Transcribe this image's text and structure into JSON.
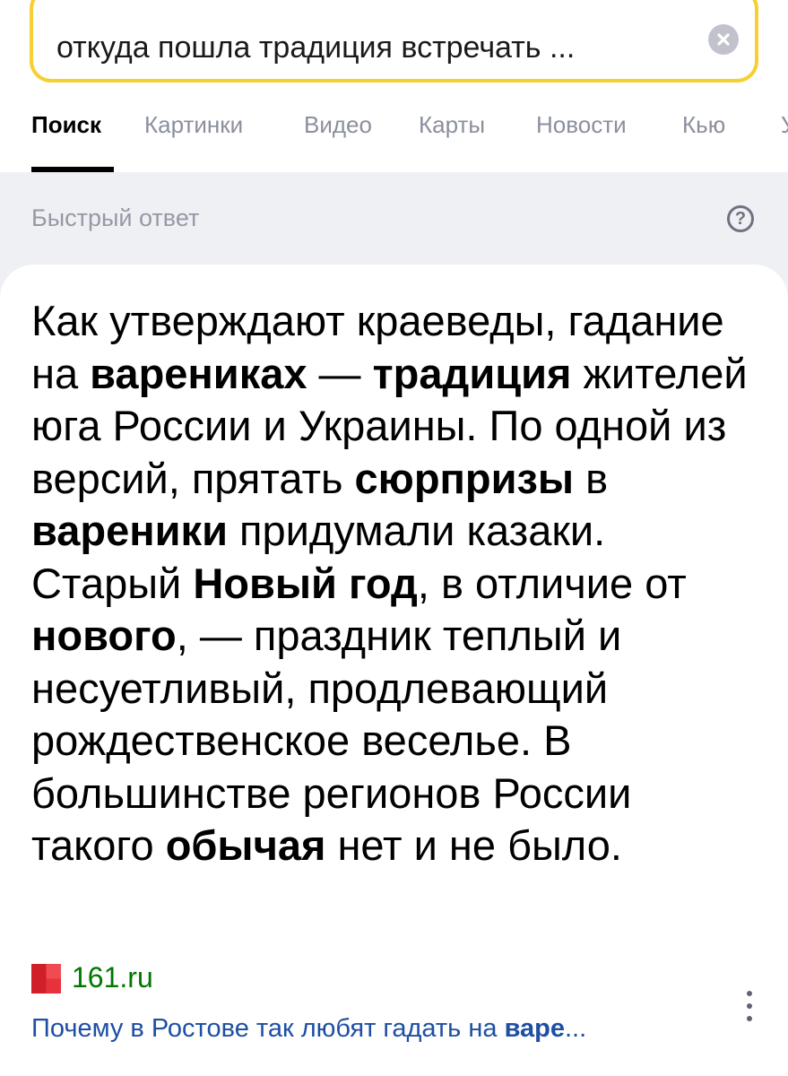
{
  "search": {
    "query": "откуда пошла традиция встречать ..."
  },
  "tabs": [
    {
      "label": "Поиск",
      "active": true
    },
    {
      "label": "Картинки",
      "active": false
    },
    {
      "label": "Видео",
      "active": false
    },
    {
      "label": "Карты",
      "active": false
    },
    {
      "label": "Новости",
      "active": false
    },
    {
      "label": "Кью",
      "active": false
    },
    {
      "label": "У",
      "active": false
    }
  ],
  "quick_answer": {
    "label": "Быстрый ответ",
    "help_symbol": "?",
    "segments": [
      {
        "text": "Как утверждают краеведы, гадание на ",
        "bold": false
      },
      {
        "text": "варениках",
        "bold": true
      },
      {
        "text": " — ",
        "bold": false
      },
      {
        "text": "традиция",
        "bold": true
      },
      {
        "text": " жителей юга России и Украины. По одной из версий, прятать ",
        "bold": false
      },
      {
        "text": "сюрпризы",
        "bold": true
      },
      {
        "text": " в ",
        "bold": false
      },
      {
        "text": "вареники",
        "bold": true
      },
      {
        "text": " придумали казаки. Старый ",
        "bold": false
      },
      {
        "text": "Новый год",
        "bold": true
      },
      {
        "text": ", в отличие от ",
        "bold": false
      },
      {
        "text": "нового",
        "bold": true
      },
      {
        "text": ", — праздник теплый и несуетливый, продлевающий рождественское веселье. В большинстве регионов России такого ",
        "bold": false
      },
      {
        "text": "обычая",
        "bold": true
      },
      {
        "text": " нет и не было.",
        "bold": false
      }
    ]
  },
  "source": {
    "domain": "161.ru",
    "title_plain": "Почему в Ростове так любят гадать на ",
    "title_bold": "варе",
    "title_ellipsis": "..."
  },
  "colors": {
    "search_border": "#f6cf31",
    "tab_inactive": "#8b8f9e",
    "background_gray": "#eff0f4",
    "source_domain": "#007700",
    "source_link": "#1e4fa3"
  },
  "icons": {
    "clear": "close-icon",
    "help": "question-icon",
    "favicon": "site-favicon",
    "more": "more-vertical-icon"
  }
}
